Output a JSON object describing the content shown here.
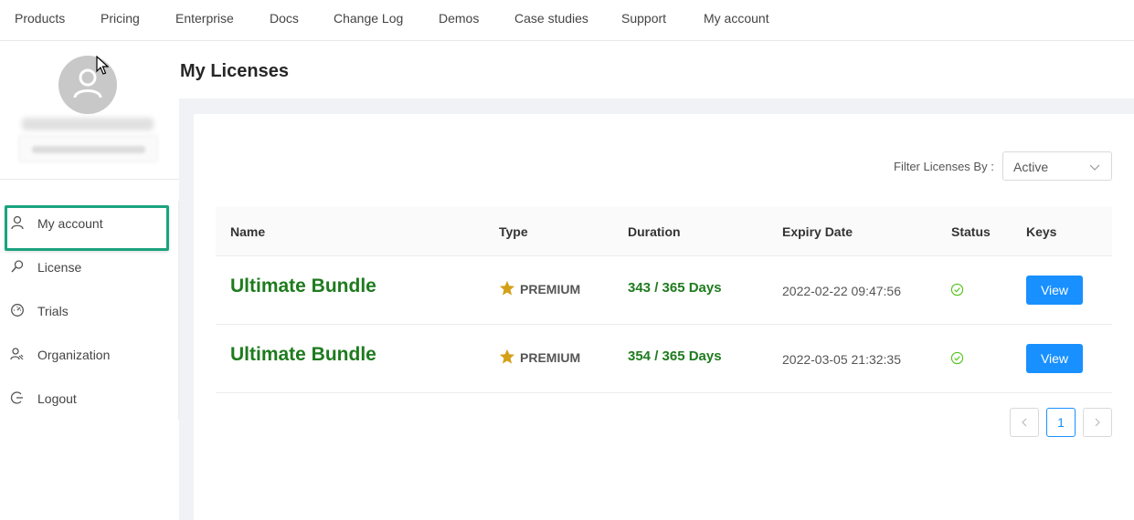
{
  "topnav": {
    "items": [
      "Products",
      "Pricing",
      "Enterprise",
      "Docs",
      "Change Log",
      "Demos",
      "Case studies",
      "Support",
      "My account"
    ]
  },
  "sidebar": {
    "menu": [
      {
        "label": "My account",
        "icon": "user-icon"
      },
      {
        "label": "License",
        "icon": "key-icon"
      },
      {
        "label": "Trials",
        "icon": "dashboard-icon"
      },
      {
        "label": "Organization",
        "icon": "team-icon"
      },
      {
        "label": "Logout",
        "icon": "logout-icon"
      }
    ]
  },
  "main": {
    "title": "My Licenses",
    "filter": {
      "label": "Filter Licenses By :",
      "value": "Active"
    },
    "table": {
      "headers": [
        "Name",
        "Type",
        "Duration",
        "Expiry Date",
        "Status",
        "Keys"
      ],
      "rows": [
        {
          "name": "Ultimate Bundle",
          "type": "PREMIUM",
          "duration": "343 / 365 Days",
          "expiry": "2022-02-22 09:47:56",
          "status": "active",
          "action": "View"
        },
        {
          "name": "Ultimate Bundle",
          "type": "PREMIUM",
          "duration": "354 / 365 Days",
          "expiry": "2022-03-05 21:32:35",
          "status": "active",
          "action": "View"
        }
      ]
    },
    "pagination": {
      "current_page": "1"
    }
  },
  "colors": {
    "accent": "#1890ff",
    "success_text": "#1e7b1e",
    "highlight": "#1aa37f",
    "star": "#d4a017"
  }
}
